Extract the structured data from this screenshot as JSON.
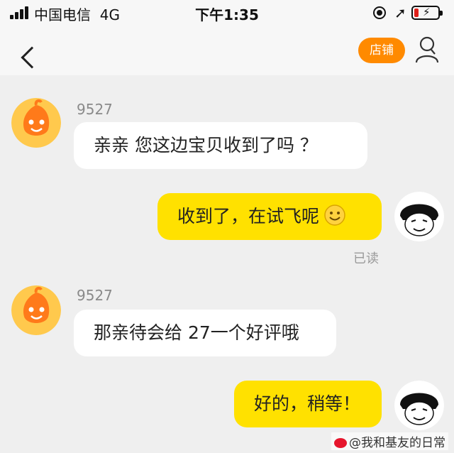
{
  "status_bar": {
    "carrier": "中国电信",
    "network": "4G",
    "time": "下午1:35"
  },
  "nav": {
    "store_label": "店铺",
    "icons": [
      "back-icon",
      "profile-icon"
    ]
  },
  "messages": [
    {
      "sender": "9527",
      "direction": "incoming",
      "text": "亲亲  您这边宝贝收到了吗 ？"
    },
    {
      "direction": "outgoing",
      "text": "收到了，在试飞呢",
      "emoji": "smile",
      "status": "已读"
    },
    {
      "sender": "9527",
      "direction": "incoming",
      "text": "那亲待会给 27一个好评哦"
    },
    {
      "direction": "outgoing",
      "text": "好的，稍等！"
    }
  ],
  "watermark": "@我和基友的日常",
  "colors": {
    "accent": "#ff8a00",
    "outgoing_bubble": "#ffe100",
    "incoming_bubble": "#ffffff",
    "background": "#efefef"
  }
}
